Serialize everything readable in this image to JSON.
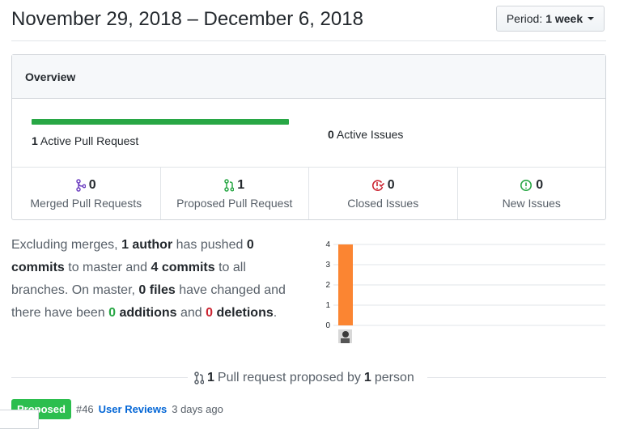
{
  "header": {
    "title": "November 29, 2018 – December 6, 2018",
    "period_prefix": "Period:",
    "period_value": "1 week"
  },
  "overview": {
    "heading": "Overview",
    "active_pr_count": "1",
    "active_pr_label": "Active Pull Request",
    "active_pr_fraction": 1.0,
    "active_issues_count": "0",
    "active_issues_label": "Active Issues",
    "stats": [
      {
        "icon": "merge-icon",
        "count": "0",
        "label": "Merged Pull Requests",
        "color": "#6f42c1"
      },
      {
        "icon": "pull-request-icon",
        "count": "1",
        "label": "Proposed Pull Request",
        "color": "#28a745"
      },
      {
        "icon": "issue-closed-icon",
        "count": "0",
        "label": "Closed Issues",
        "color": "#cb2431"
      },
      {
        "icon": "issue-opened-icon",
        "count": "0",
        "label": "New Issues",
        "color": "#28a745"
      }
    ]
  },
  "summary": {
    "t1": "Excluding merges, ",
    "authors": "1 author",
    "t2": " has pushed ",
    "commits_master": "0 commits",
    "t3": " to master and ",
    "commits_all": "4 commits",
    "t4": " to all branches. On master, ",
    "files": "0 files",
    "t5": " have changed and there have been ",
    "additions_num": "0",
    "additions_word": " additions",
    "t6": " and ",
    "deletions_num": "0",
    "deletions_word": " deletions",
    "t7": "."
  },
  "chart_data": {
    "type": "bar",
    "categories": [
      "author-1"
    ],
    "values": [
      4
    ],
    "ylim": [
      0,
      4
    ],
    "yticks": [
      "0",
      "1",
      "2",
      "3",
      "4"
    ],
    "bar_color": "#fb8532",
    "grid": true
  },
  "proposed": {
    "count": "1",
    "text": "Pull request proposed by",
    "people_count": "1",
    "people_word": "person"
  },
  "pull_requests": [
    {
      "badge": "Proposed",
      "number": "#46",
      "title": "User Reviews",
      "time": "3 days ago"
    }
  ]
}
